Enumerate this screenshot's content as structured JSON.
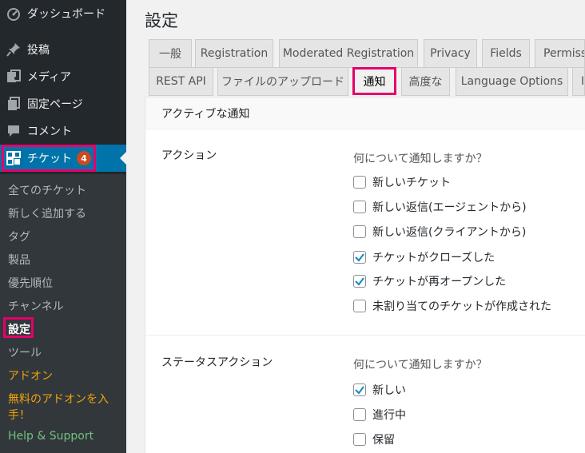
{
  "sidebar": {
    "items": [
      {
        "label": "ダッシュボード",
        "icon": "dashboard-icon"
      },
      {
        "label": "投稿",
        "icon": "pin-icon"
      },
      {
        "label": "メディア",
        "icon": "media-icon"
      },
      {
        "label": "固定ページ",
        "icon": "page-icon"
      },
      {
        "label": "コメント",
        "icon": "comment-icon"
      },
      {
        "label": "チケット",
        "icon": "ticket-grid-icon",
        "badge": "4"
      }
    ],
    "submenu": [
      {
        "label": "全てのチケット"
      },
      {
        "label": "新しく追加する"
      },
      {
        "label": "タグ"
      },
      {
        "label": "製品"
      },
      {
        "label": "優先順位"
      },
      {
        "label": "チャンネル"
      },
      {
        "label": "設定"
      },
      {
        "label": "ツール"
      },
      {
        "label": "アドオン"
      },
      {
        "label": "無料のアドオンを入"
      },
      {
        "label": "手！"
      },
      {
        "label": "Help & Support"
      }
    ]
  },
  "page": {
    "title": "設定"
  },
  "tabs": {
    "row1": [
      "一般",
      "Registration",
      "Moderated Registration",
      "Privacy",
      "Fields",
      "Permissi"
    ],
    "row2": [
      "REST API",
      "ファイルのアップロード",
      "通知",
      "高度な",
      "Language Options",
      "I"
    ]
  },
  "panel": {
    "header": "アクティブな通知",
    "sections": [
      {
        "label": "アクション",
        "question": "何について通知しますか？",
        "options": [
          {
            "label": "新しいチケット",
            "checked": false
          },
          {
            "label": "新しい返信(エージェントから)",
            "checked": false
          },
          {
            "label": "新しい返信(クライアントから)",
            "checked": false
          },
          {
            "label": "チケットがクローズした",
            "checked": true
          },
          {
            "label": "チケットが再オープンした",
            "checked": true
          },
          {
            "label": "未割り当てのチケットが作成された",
            "checked": false
          }
        ]
      },
      {
        "label": "ステータスアクション",
        "question": "何について通知しますか？",
        "options": [
          {
            "label": "新しい",
            "checked": true
          },
          {
            "label": "進行中",
            "checked": false
          },
          {
            "label": "保留",
            "checked": false
          }
        ]
      }
    ]
  },
  "colors": {
    "sidebar_bg": "#23282d",
    "submenu_bg": "#32373c",
    "current_bg": "#0073aa",
    "highlight": "#e5006a",
    "badge": "#ca4a1f",
    "addon_orange": "#f0a30a",
    "help_green": "#70c27d",
    "check_blue": "#1e8cbe"
  }
}
